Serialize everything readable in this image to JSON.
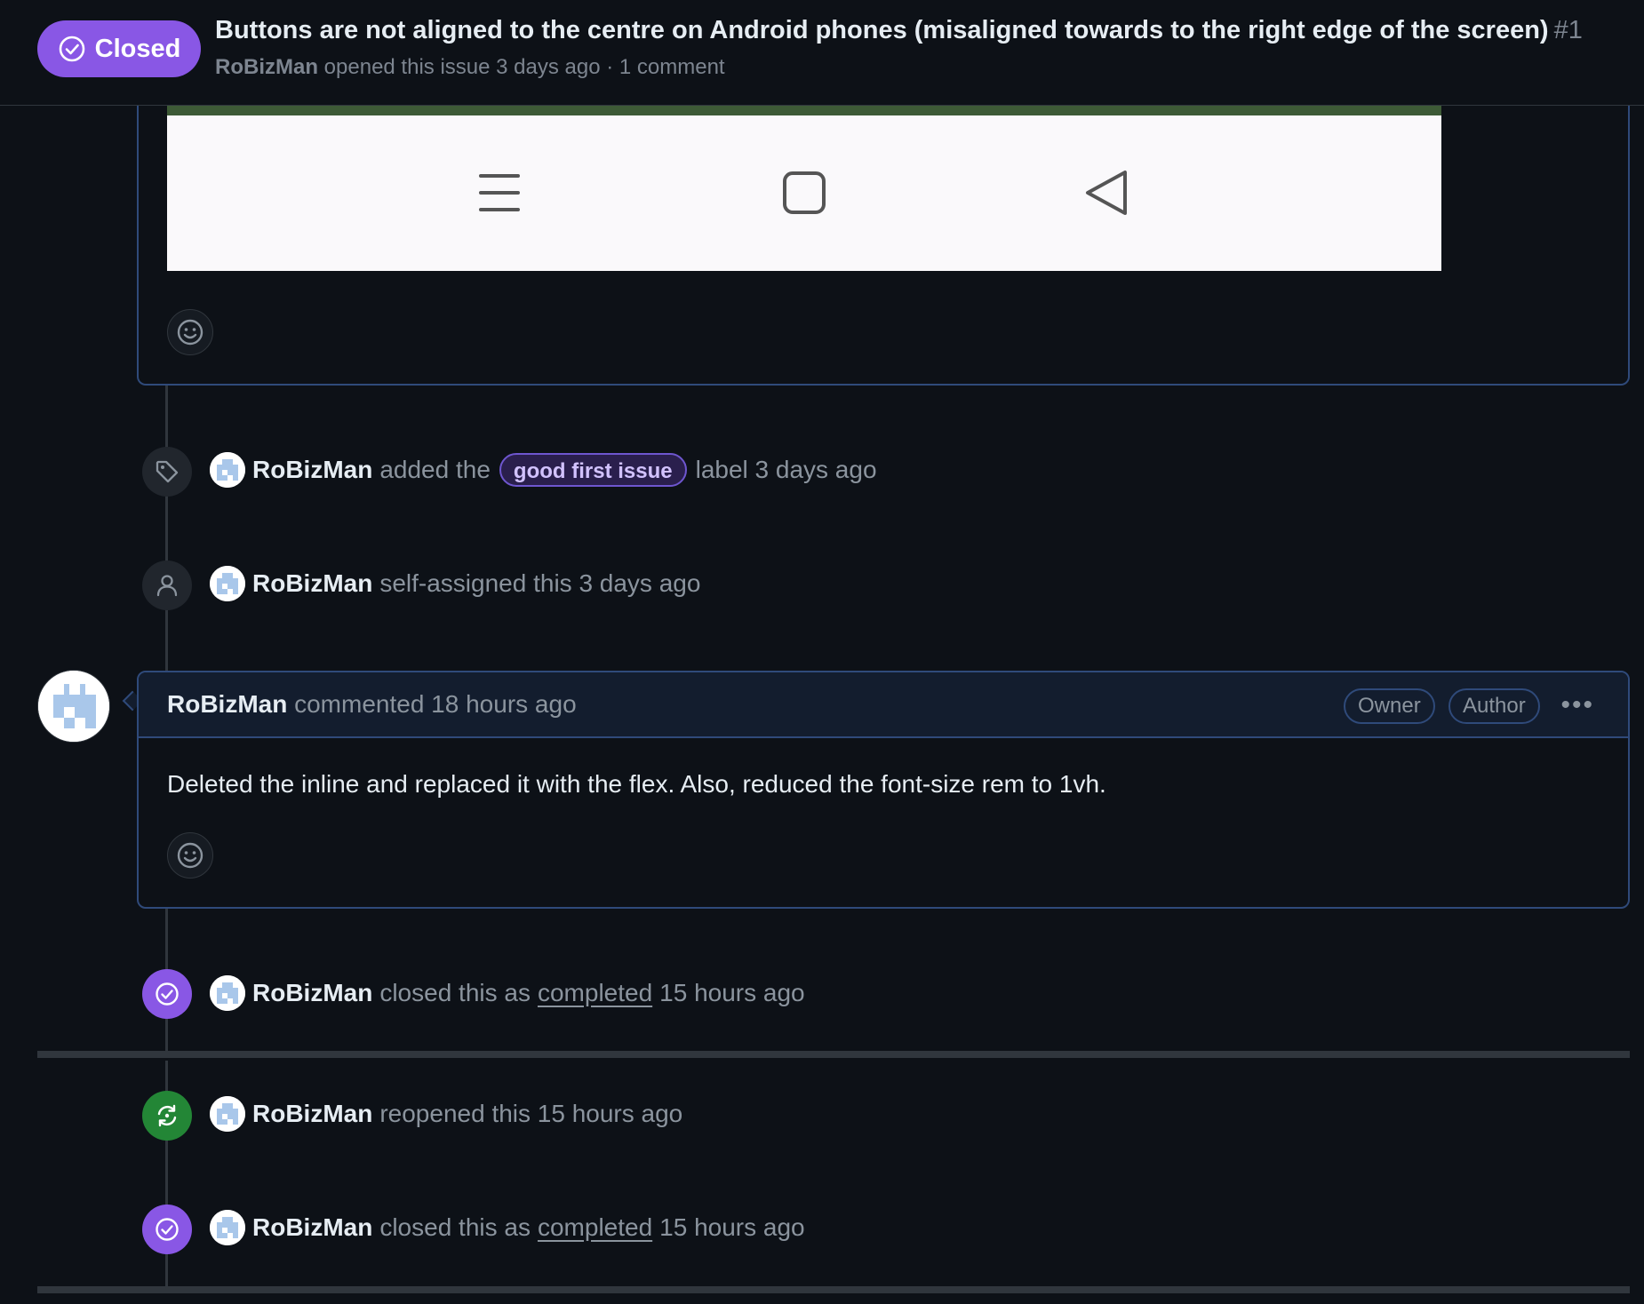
{
  "header": {
    "state": "Closed",
    "title": "Buttons are not aligned to the centre on Android phones (misaligned towards to the right edge of the screen)",
    "number": "#1",
    "author": "RoBizMan",
    "meta": "opened this issue 3 days ago · 1 comment"
  },
  "events": {
    "label_added": {
      "actor": "RoBizMan",
      "pre": "added the",
      "label": "good first issue",
      "post": "label 3 days ago"
    },
    "self_assigned": {
      "actor": "RoBizMan",
      "text": "self-assigned this 3 days ago"
    },
    "closed_1": {
      "actor": "RoBizMan",
      "pre": "closed this as",
      "link": "completed",
      "post": "15 hours ago"
    },
    "reopened": {
      "actor": "RoBizMan",
      "text": "reopened this 15 hours ago"
    },
    "closed_2": {
      "actor": "RoBizMan",
      "pre": "closed this as",
      "link": "completed",
      "post": "15 hours ago"
    }
  },
  "comment": {
    "author": "RoBizMan",
    "action": "commented 18 hours ago",
    "badges": [
      "Owner",
      "Author"
    ],
    "menu_label": "•••",
    "body": "Deleted the inline and replaced it with the flex. Also, reduced the font-size rem to 1vh."
  },
  "icons": {
    "state": "check-circle-icon",
    "label": "tag-icon",
    "assign": "person-icon",
    "closed": "check-circle-icon",
    "reopened": "sync-icon",
    "reaction": "smiley-icon"
  },
  "colors": {
    "closed_purple": "#8957e5",
    "reopened_green": "#238636",
    "background": "#0d1117",
    "comment_border": "#2f4a7a"
  }
}
